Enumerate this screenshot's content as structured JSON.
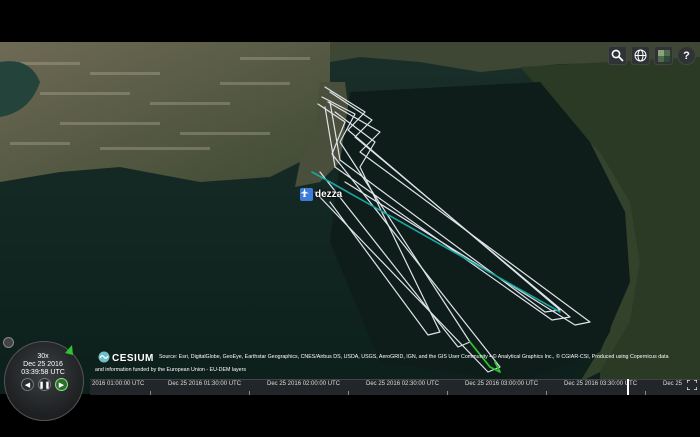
{
  "toolbar": {
    "search_icon": "search-icon",
    "globe_icon": "globe-icon",
    "layers_icon": "layers-icon",
    "help_icon": "help-icon",
    "help_label": "?"
  },
  "marker": {
    "label": "dezza",
    "icon": "plane-icon",
    "color": "#3b7dd8"
  },
  "credits": {
    "logo_text": "CESIUM",
    "line1": "Source: Esri, DigitalGlobe, GeoEye, Earthstar Geographics, CNES/Airbus DS, USDA, USGS, AeroGRID, IGN, and the GIS User Community • © Analytical Graphics Inc., © CGIAR-CSI, Produced using Copernicus data",
    "line2": "and information funded by the European Union - EU-DEM layers"
  },
  "animation": {
    "speed": "30x",
    "date": "Dec 25 2016",
    "time": "03:39:58 UTC",
    "reverse_label": "◀",
    "pause_label": "❚❚",
    "play_label": "▶"
  },
  "timeline": {
    "labels": [
      "2016 01:00:00 UTC",
      "Dec 25 2016 01:30:00 UTC",
      "Dec 25 2016 02:00:00 UTC",
      "Dec 25 2016 02:30:00 UTC",
      "Dec 25 2016 03:00:00 UTC",
      "Dec 25 2016 03:30:00 UTC",
      "Dec 25"
    ]
  },
  "colors": {
    "track": "#dfe3ea",
    "track_highlight": "#1aa5a0",
    "track_green": "#2ec52e",
    "water": "#0f2a24"
  }
}
